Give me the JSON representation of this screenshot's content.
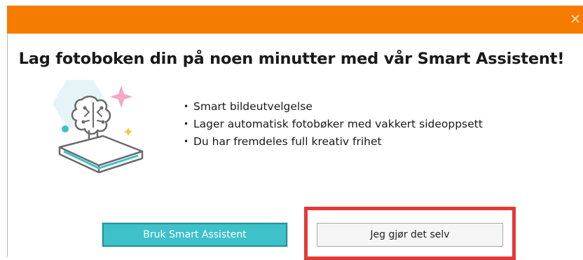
{
  "dialog": {
    "close_label": "✕",
    "headline": "Lag fotoboken din på noen minutter med vår Smart Assistent!",
    "features": [
      "Smart bildeutvelgelse",
      "Lager automatisk fotobøker med vakkert sideoppsett",
      "Du har fremdeles full kreativ frihet"
    ],
    "bullet": "•",
    "primary_button": "Bruk Smart Assistent",
    "secondary_button": "Jeg gjør det selv",
    "illustration_icon": "brain-book-icon"
  },
  "colors": {
    "titlebar": "#f57c00",
    "primary_button": "#3ec1c9",
    "highlight": "#e53935"
  }
}
